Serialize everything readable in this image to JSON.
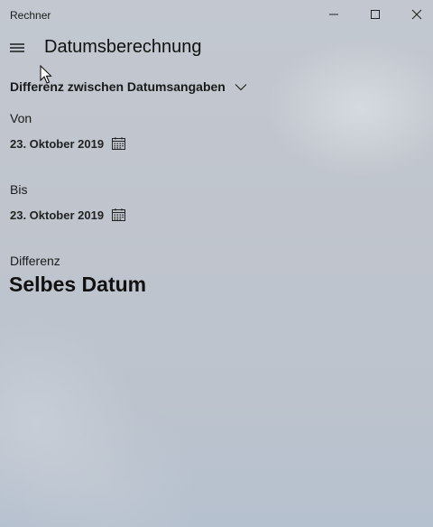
{
  "window": {
    "title": "Rechner",
    "controls": {
      "minimize_icon": "minimize-icon",
      "maximize_icon": "maximize-icon",
      "close_icon": "close-icon"
    }
  },
  "header": {
    "menu_icon": "hamburger-menu-icon",
    "title": "Datumsberechnung"
  },
  "mode": {
    "selected": "Differenz zwischen Datumsangaben",
    "icon": "chevron-down-icon"
  },
  "from": {
    "label": "Von",
    "date": "23. Oktober 2019",
    "icon": "calendar-icon"
  },
  "to": {
    "label": "Bis",
    "date": "23. Oktober 2019",
    "icon": "calendar-icon"
  },
  "difference": {
    "label": "Differenz",
    "value": "Selbes Datum"
  },
  "colors": {
    "background": "#c0c5cd",
    "text": "#111111"
  }
}
